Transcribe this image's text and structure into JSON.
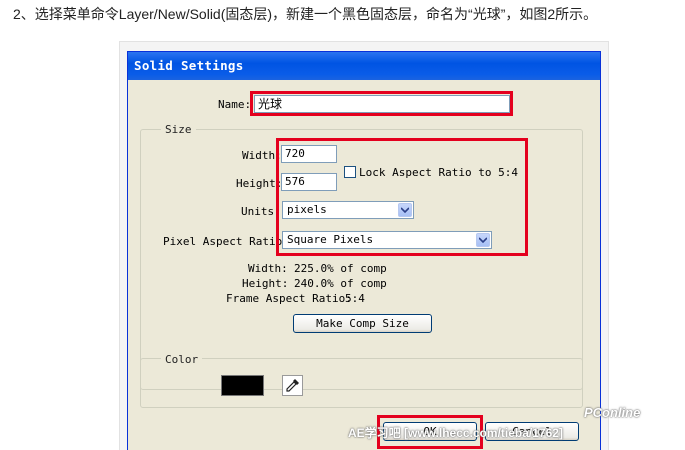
{
  "instruction": "2、选择菜单命令Layer/New/Solid(固态层)，新建一个黑色固态层，命名为“光球”，如图2所示。",
  "dialog": {
    "title": "Solid Settings",
    "name_label": "Name:",
    "name_value": "光球",
    "size": {
      "legend": "Size",
      "width_label": "Width:",
      "width_value": "720",
      "height_label": "Height:",
      "height_value": "576",
      "lock_label": "Lock Aspect Ratio to 5:4",
      "lock_checked": false,
      "units_label": "Units:",
      "units_value": "pixels",
      "par_label": "Pixel Aspect Ratio:",
      "par_value": "Square Pixels",
      "info_width_label": "Width:",
      "info_width_value": "225.0% of comp",
      "info_height_label": "Height:",
      "info_height_value": "240.0% of comp",
      "frame_ratio_label": "Frame Aspect Ratio:",
      "frame_ratio_value": "5:4",
      "make_comp_size": "Make Comp Size"
    },
    "color": {
      "legend": "Color",
      "swatch": "#000000",
      "eyedropper_icon": "eyedropper-icon"
    },
    "ok_label": "OK",
    "cancel_label": "Cancel"
  },
  "highlight_color": "#e4001e",
  "watermark": {
    "brand": "PConline",
    "text": "AE学习吧 [www.lhecc.com/tieba/1762]"
  }
}
